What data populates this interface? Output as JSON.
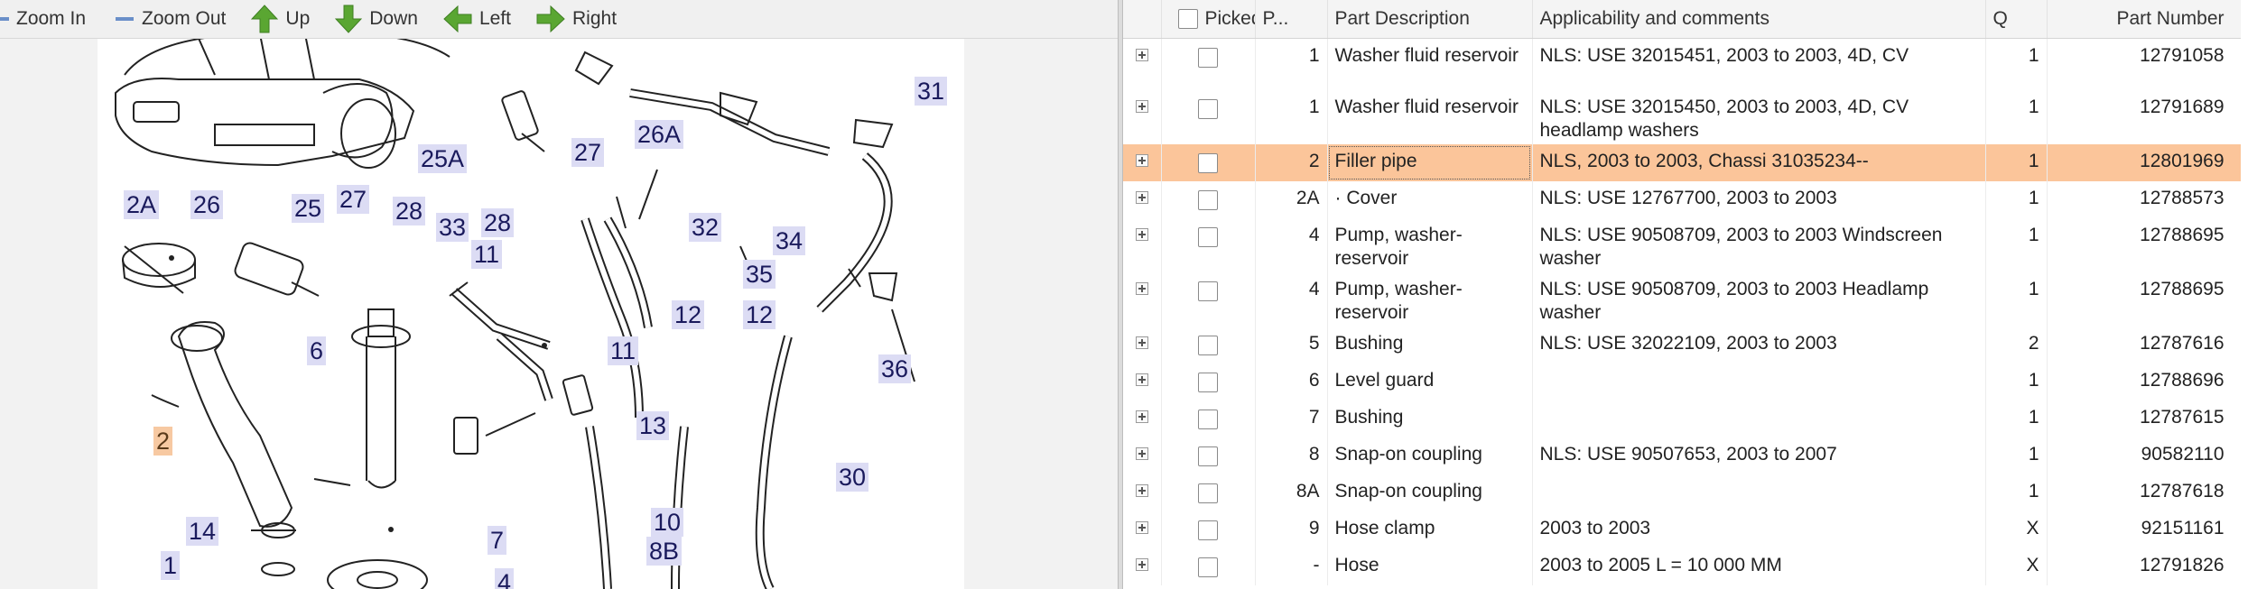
{
  "toolbar": {
    "zoom_in": "Zoom In",
    "zoom_out": "Zoom Out",
    "up": "Up",
    "down": "Down",
    "left": "Left",
    "right": "Right"
  },
  "diagram": {
    "callouts": [
      "31",
      "25A",
      "27",
      "26A",
      "2A",
      "26",
      "25",
      "27",
      "28",
      "33",
      "28",
      "32",
      "11",
      "12",
      "34",
      "35",
      "12",
      "6",
      "11",
      "36",
      "13",
      "2",
      "30",
      "14",
      "10",
      "7",
      "8B",
      "1",
      "4"
    ],
    "highlighted": "2"
  },
  "table": {
    "columns": {
      "picked": "Picked",
      "pos": "P...",
      "description": "Part Description",
      "applicability": "Applicability and comments",
      "qty": "Q",
      "part_number": "Part Number"
    },
    "rows": [
      {
        "pos": "1",
        "desc": "Washer fluid reservoir",
        "app": "NLS: USE 32015451, 2003 to 2003, 4D, CV",
        "qty": "1",
        "pn": "12791058"
      },
      {
        "pos": "1",
        "desc": "Washer fluid reservoir",
        "app": "NLS: USE 32015450, 2003 to 2003, 4D, CV headlamp washers",
        "qty": "1",
        "pn": "12791689"
      },
      {
        "pos": "2",
        "desc": "Filler pipe",
        "app": "NLS, 2003 to 2003, Chassi 31035234--",
        "qty": "1",
        "pn": "12801969",
        "selected": true
      },
      {
        "pos": "2A",
        "desc": "· Cover",
        "app": "NLS: USE 12767700, 2003 to 2003",
        "qty": "1",
        "pn": "12788573"
      },
      {
        "pos": "4",
        "desc": "Pump, washer-reservoir",
        "app": "NLS: USE 90508709, 2003 to 2003 Windscreen washer",
        "qty": "1",
        "pn": "12788695"
      },
      {
        "pos": "4",
        "desc": "Pump, washer-reservoir",
        "app": "NLS: USE 90508709, 2003 to 2003 Headlamp washer",
        "qty": "1",
        "pn": "12788695"
      },
      {
        "pos": "5",
        "desc": "Bushing",
        "app": "NLS: USE 32022109, 2003 to 2003",
        "qty": "2",
        "pn": "12787616"
      },
      {
        "pos": "6",
        "desc": "Level guard",
        "app": "",
        "qty": "1",
        "pn": "12788696"
      },
      {
        "pos": "7",
        "desc": "Bushing",
        "app": "",
        "qty": "1",
        "pn": "12787615"
      },
      {
        "pos": "8",
        "desc": "Snap-on coupling",
        "app": "NLS: USE 90507653, 2003 to 2007",
        "qty": "1",
        "pn": "90582110"
      },
      {
        "pos": "8A",
        "desc": "Snap-on coupling",
        "app": "",
        "qty": "1",
        "pn": "12787618"
      },
      {
        "pos": "9",
        "desc": "Hose clamp",
        "app": "2003 to 2003",
        "qty": "X",
        "pn": "92151161"
      },
      {
        "pos": "-",
        "desc": "Hose",
        "app": "2003 to 2005 L = 10 000 MM",
        "qty": "X",
        "pn": "12791826"
      }
    ]
  },
  "colors": {
    "selected_row": "#fbc59a",
    "callout_bg": "#dcdcf4",
    "callout_highlight": "#f7c9a2",
    "arrow_green": "#5aa632"
  }
}
